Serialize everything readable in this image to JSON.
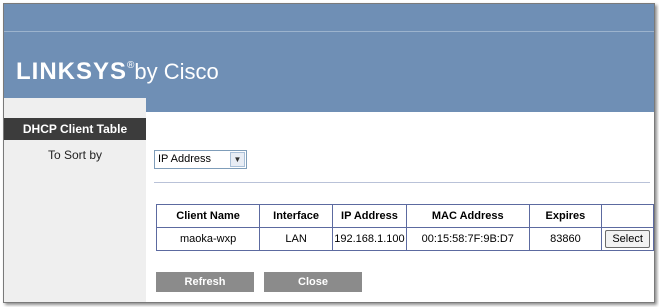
{
  "header": {
    "brand": "LINKSYS",
    "registered": "®",
    "byline": "by Cisco"
  },
  "sidebar": {
    "title": "DHCP Client Table",
    "sort_label": "To Sort by"
  },
  "sort": {
    "selected": "IP Address"
  },
  "table": {
    "headers": [
      "Client Name",
      "Interface",
      "IP Address",
      "MAC Address",
      "Expires",
      ""
    ],
    "rows": [
      {
        "client_name": "maoka-wxp",
        "interface": "LAN",
        "ip_address": "192.168.1.100",
        "mac_address": "00:15:58:7F:9B:D7",
        "expires": "83860",
        "action_label": "Select"
      }
    ]
  },
  "buttons": {
    "refresh_label": "Refresh",
    "close_label": "Close"
  },
  "colors": {
    "banner": "#6f8fb5",
    "sidebar_title": "#3c3c3c",
    "button": "#8b8b8b",
    "table_border": "#5c6aa0"
  }
}
